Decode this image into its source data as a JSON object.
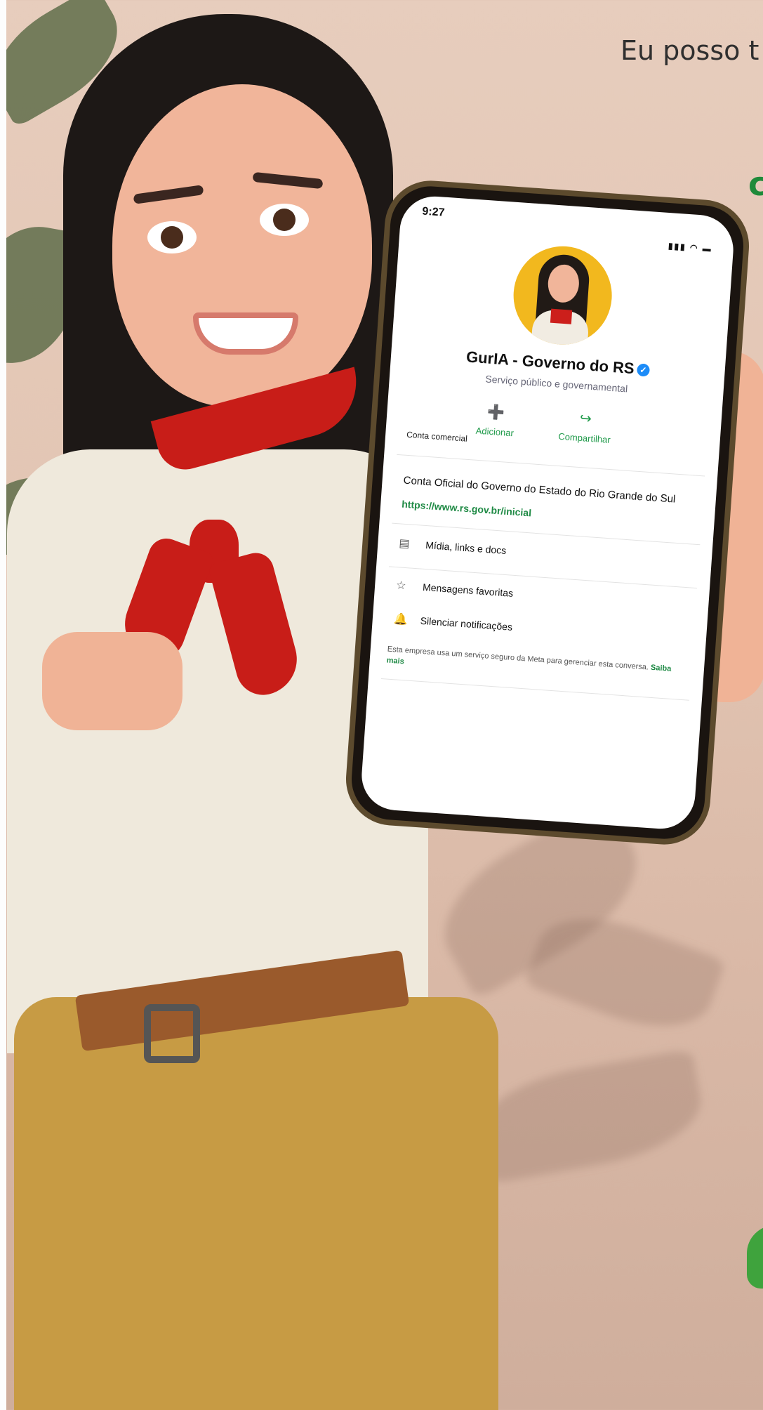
{
  "promo": {
    "headline_partial": "Eu posso t",
    "green_partial": "c"
  },
  "phone": {
    "status_time": "9:27",
    "status_icons": "▮▮▮ ◠ ▬",
    "profile_name": "GurIA - Governo do RS",
    "verified_badge": "✓",
    "category": "Serviço público e governamental",
    "actions": [
      {
        "label": "Adicionar",
        "icon": "add-person-icon",
        "glyph": "➕"
      },
      {
        "label": "Compartilhar",
        "icon": "share-icon",
        "glyph": "↪"
      }
    ],
    "section_label": "Conta comercial",
    "description": "Conta Oficial do Governo do Estado do Rio Grande do Sul",
    "link": "https://www.rs.gov.br/inicial",
    "menu": [
      {
        "label": "Mídia, links e docs",
        "icon": "media-icon",
        "glyph": "▤"
      },
      {
        "label": "Mensagens favoritas",
        "icon": "star-icon",
        "glyph": "☆"
      },
      {
        "label": "Silenciar notificações",
        "icon": "bell-icon",
        "glyph": "🔔"
      }
    ],
    "footer_text": "Esta empresa usa um serviço seguro da Meta para gerenciar esta conversa.",
    "footer_link": "Saiba mais"
  },
  "colors": {
    "brand_green": "#1f8a45",
    "scarf_red": "#c81d18",
    "avatar_yellow": "#f2b81e"
  }
}
